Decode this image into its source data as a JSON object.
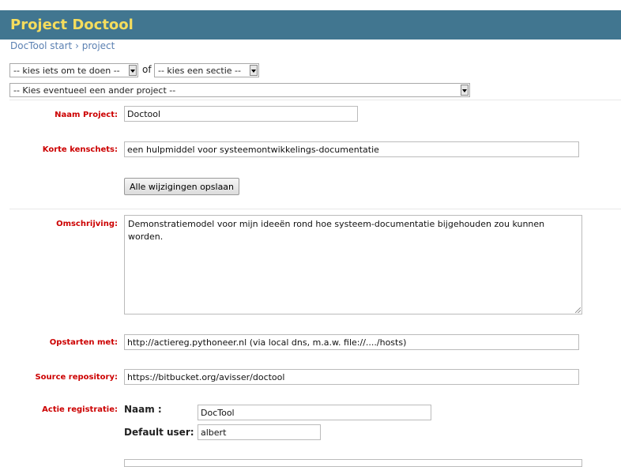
{
  "header": {
    "title": "Project Doctool"
  },
  "breadcrumb": {
    "home": "DocTool start",
    "separator": " › ",
    "current": "project"
  },
  "controls": {
    "action_select": "-- kies iets om te doen --",
    "of_text": "of",
    "section_select": "-- kies een sectie --",
    "project_select": "-- Kies eventueel een ander project --"
  },
  "form": {
    "naam_label": "Naam Project:",
    "naam_value": "Doctool",
    "kenschets_label": "Korte kenschets:",
    "kenschets_value": "een hulpmiddel voor systeemontwikkelings-documentatie",
    "save_label": "Alle wijzigingen opslaan",
    "omschrijving_label": "Omschrijving:",
    "omschrijving_value": "Demonstratiemodel voor mijn ideeën rond hoe systeem-documentatie bijgehouden zou kunnen worden.",
    "opstarten_label": "Opstarten met:",
    "opstarten_value": "http://actiereg.pythoneer.nl (via local dns, m.a.w. file://..../hosts)",
    "source_label": "Source repository:",
    "source_value": "https://bitbucket.org/avisser/doctool",
    "actie_label": "Actie registratie:",
    "actie_naam_label": "Naam :",
    "actie_naam_value": "DocTool",
    "actie_user_label": "Default user:",
    "actie_user_value": "albert"
  },
  "colors": {
    "header_bg": "#417690",
    "title": "#f5dd5d",
    "label": "#cc0000",
    "link": "#5b80b2"
  }
}
